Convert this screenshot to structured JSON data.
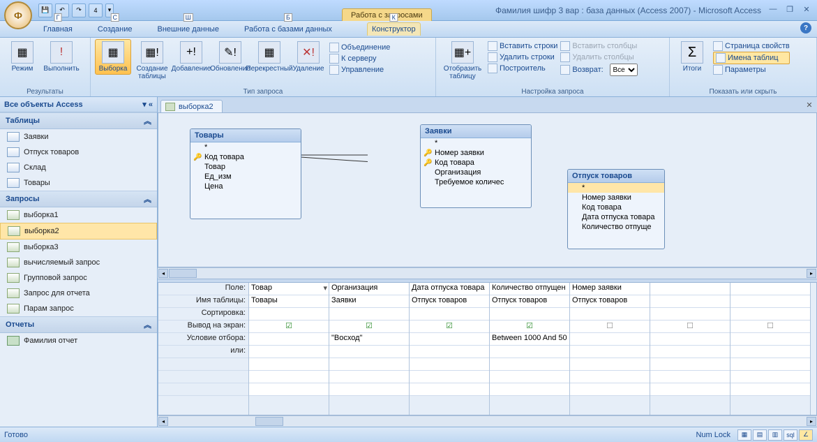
{
  "title": "Фамилия шифр 3 вар : база данных (Access 2007) - Microsoft Access",
  "context_tab": "Работа с запросами",
  "menu": {
    "items": [
      "Главная",
      "Создание",
      "Внешние данные",
      "Работа с базами данных"
    ],
    "ctx": "Конструктор",
    "keys": [
      "Г",
      "С",
      "Ш",
      "Б",
      "К"
    ]
  },
  "ribbon": {
    "g1": {
      "label": "Результаты",
      "b": [
        "Режим",
        "Выполнить"
      ]
    },
    "g2": {
      "label": "Тип запроса",
      "b": [
        "Выборка",
        "Создание таблицы",
        "Добавление",
        "Обновление",
        "Перекрестный",
        "Удаление"
      ],
      "links": [
        "Объединение",
        "К серверу",
        "Управление"
      ]
    },
    "g3": {
      "label": "Настройка запроса",
      "show": "Отобразить таблицу",
      "rows": [
        "Вставить строки",
        "Удалить строки",
        "Построитель"
      ],
      "cols": [
        "Вставить столбцы",
        "Удалить столбцы",
        "Возврат:"
      ],
      "ret": "Все"
    },
    "g4": {
      "label": "Показать или скрыть",
      "itog": "Итоги",
      "links": [
        "Страница свойств",
        "Имена таблиц",
        "Параметры"
      ]
    }
  },
  "nav": {
    "title": "Все объекты Access",
    "sec1": "Таблицы",
    "tables": [
      "Заявки",
      "Отпуск товаров",
      "Склад",
      "Товары"
    ],
    "sec2": "Запросы",
    "queries": [
      "выборка1",
      "выборка2",
      "выборка3",
      "вычисляемый запрос",
      "Групповой запрос",
      "Запрос для отчета",
      "Парам запрос"
    ],
    "sec3": "Отчеты",
    "reports": [
      "Фамилия отчет"
    ]
  },
  "doc_tab": "выборка2",
  "diagram": {
    "t1": {
      "title": "Товары",
      "fields": [
        "*",
        "Код товара",
        "Товар",
        "Ед_изм",
        "Цена"
      ]
    },
    "t2": {
      "title": "Заявки",
      "fields": [
        "*",
        "Номер заявки",
        "Код товара",
        "Организация",
        "Требуемое количес"
      ]
    },
    "t3": {
      "title": "Отпуск товаров",
      "fields": [
        "*",
        "Номер заявки",
        "Код товара",
        "Дата отпуска товара",
        "Количество отпуще"
      ]
    }
  },
  "grid": {
    "rows": [
      "Поле:",
      "Имя таблицы:",
      "Сортировка:",
      "Вывод на экран:",
      "Условие отбора:",
      "или:"
    ],
    "cols": [
      {
        "f": "Товар",
        "t": "Товары",
        "o": true,
        "c": ""
      },
      {
        "f": "Организация",
        "t": "Заявки",
        "o": true,
        "c": "\"Восход\""
      },
      {
        "f": "Дата отпуска товара",
        "t": "Отпуск товаров",
        "o": true,
        "c": ""
      },
      {
        "f": "Количество отпущен",
        "t": "Отпуск товаров",
        "o": true,
        "c": "Between 1000 And 50"
      },
      {
        "f": "Номер заявки",
        "t": "Отпуск товаров",
        "o": false,
        "c": ""
      },
      {
        "f": "",
        "t": "",
        "o": false,
        "c": ""
      },
      {
        "f": "",
        "t": "",
        "o": false,
        "c": ""
      }
    ]
  },
  "status": {
    "left": "Готово",
    "right": "Num Lock"
  }
}
